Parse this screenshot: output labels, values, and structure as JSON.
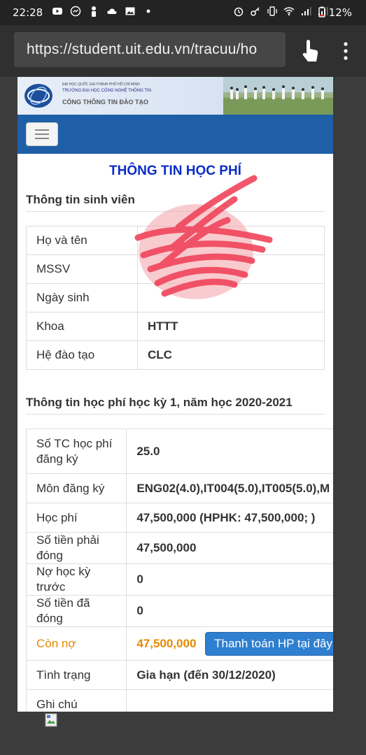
{
  "status_bar": {
    "time": "22:28",
    "battery": "12%"
  },
  "browser": {
    "url": "https://student.uit.edu.vn/tracuu/ho"
  },
  "banner": {
    "line1": "ĐẠI HỌC QUỐC GIA THÀNH PHỐ HỒ CHÍ MINH",
    "line2": "TRƯỜNG ĐẠI HỌC CÔNG NGHỆ THÔNG TIN",
    "line3": "CỔNG THÔNG TIN ĐÀO TẠO"
  },
  "page_title": "THÔNG TIN HỌC PHÍ",
  "student_info": {
    "title": "Thông tin sinh viên",
    "rows": [
      {
        "label": "Họ và tên",
        "value": ""
      },
      {
        "label": "MSSV",
        "value": ""
      },
      {
        "label": "Ngày sinh",
        "value": ""
      },
      {
        "label": "Khoa",
        "value": "HTTT"
      },
      {
        "label": "Hệ đào tạo",
        "value": "CLC"
      }
    ]
  },
  "tuition_info": {
    "title": "Thông tin học phí học kỳ 1, năm học 2020-2021",
    "rows": [
      {
        "label": "Số TC học phí đăng ký",
        "value": "25.0"
      },
      {
        "label": "Môn đăng ký",
        "value": "ENG02(4.0),IT004(5.0),IT005(5.0),M"
      },
      {
        "label": "Học phí",
        "value": "47,500,000 (HPHK: 47,500,000; )"
      },
      {
        "label": "Số tiền phải đóng",
        "value": "47,500,000"
      },
      {
        "label": "Nợ học kỳ trước",
        "value": "0"
      },
      {
        "label": "Số tiền đã đóng",
        "value": "0"
      },
      {
        "label": "Còn nợ",
        "value": "47,500,000",
        "button": "Thanh toán HP tại đây"
      },
      {
        "label": "Tình trạng",
        "value": "Gia hạn (đến 30/12/2020)"
      },
      {
        "label": "Ghi chú",
        "value": ""
      }
    ]
  },
  "colors": {
    "title_blue": "#0a2cc9",
    "navbar": "#1e5fa8",
    "owe_orange": "#e38a00",
    "pay_button": "#2f7fd0"
  }
}
